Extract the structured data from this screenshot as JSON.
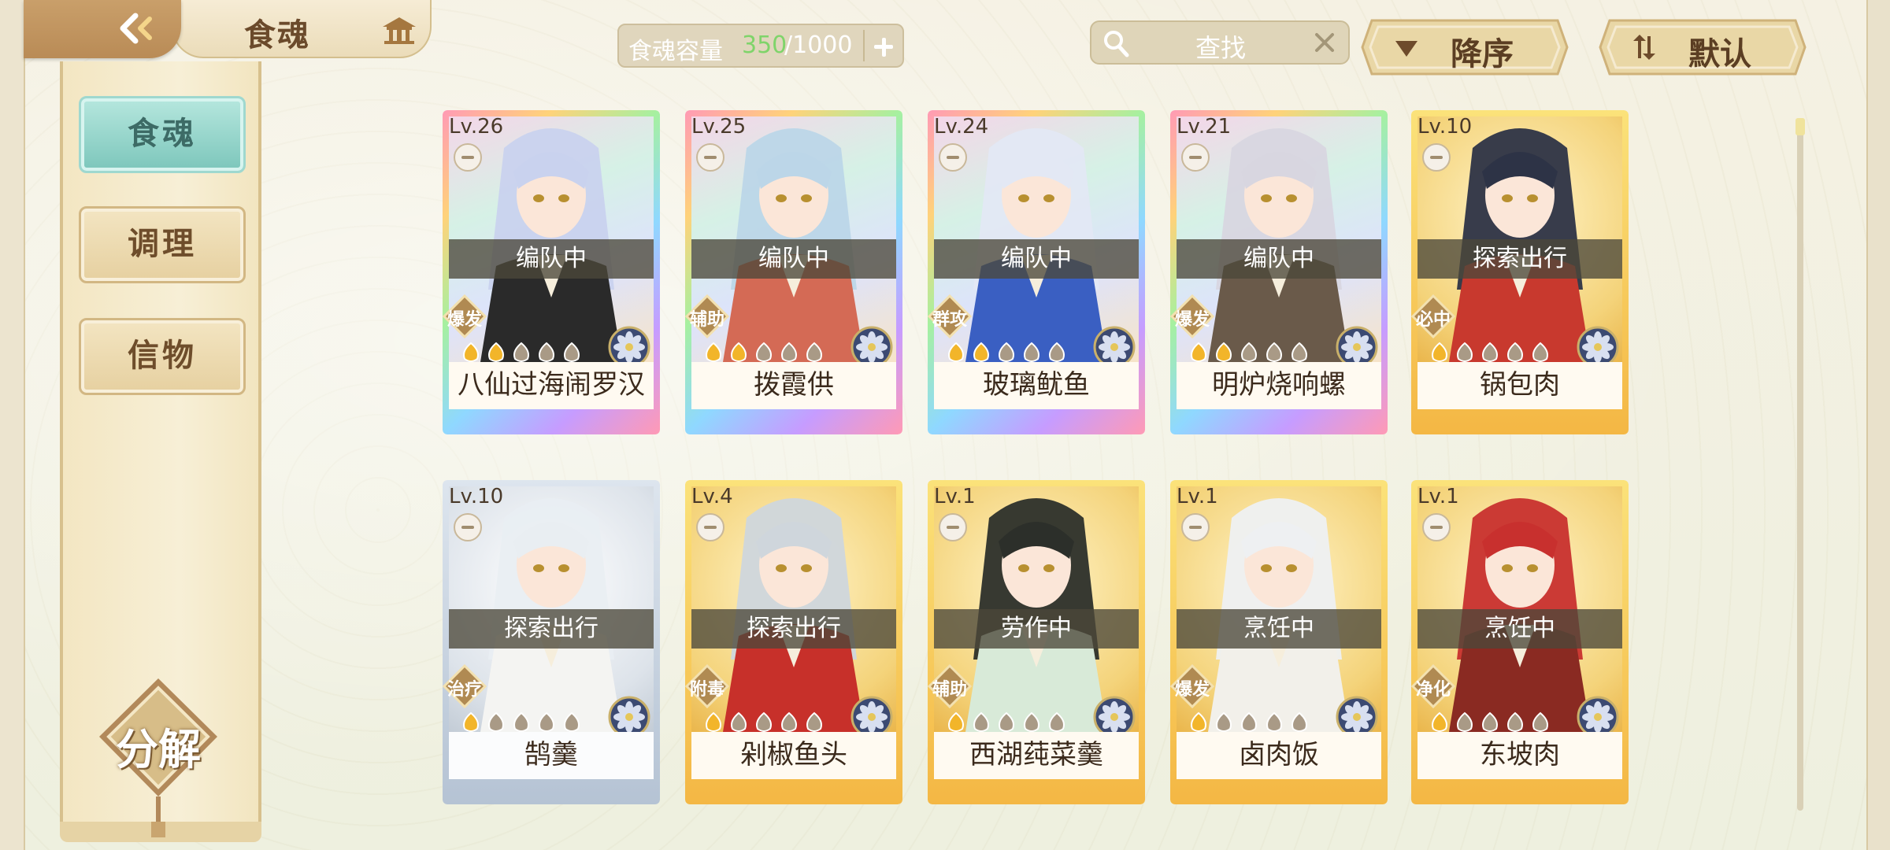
{
  "header": {
    "title": "食魂",
    "capacity_label": "食魂容量",
    "capacity_current": "350",
    "capacity_max": "/1000",
    "search_text": "查找",
    "sort_order_label": "降序",
    "sort_mode_label": "默认"
  },
  "sidebar": {
    "items": [
      {
        "label": "食魂",
        "active": true
      },
      {
        "label": "调理",
        "active": false
      },
      {
        "label": "信物",
        "active": false
      }
    ],
    "decompose_label": "分解"
  },
  "cards": [
    {
      "level": "Lv.26",
      "status": "编队中",
      "role": "爆发",
      "stars": 2,
      "name": "八仙过海闹罗汉",
      "rarity": "rainbow"
    },
    {
      "level": "Lv.25",
      "status": "编队中",
      "role": "辅助",
      "stars": 2,
      "name": "拨霞供",
      "rarity": "rainbow"
    },
    {
      "level": "Lv.24",
      "status": "编队中",
      "role": "群攻",
      "stars": 2,
      "name": "玻璃鱿鱼",
      "rarity": "rainbow"
    },
    {
      "level": "Lv.21",
      "status": "编队中",
      "role": "爆发",
      "stars": 2,
      "name": "明炉烧响螺",
      "rarity": "rainbow"
    },
    {
      "level": "Lv.10",
      "status": "探索出行",
      "role": "必中",
      "stars": 1,
      "name": "锅包肉",
      "rarity": "gold"
    },
    {
      "level": "Lv.10",
      "status": "探索出行",
      "role": "治疗",
      "stars": 1,
      "name": "鹄羹",
      "rarity": "silver"
    },
    {
      "level": "Lv.4",
      "status": "探索出行",
      "role": "附毒",
      "stars": 1,
      "name": "剁椒鱼头",
      "rarity": "gold"
    },
    {
      "level": "Lv.1",
      "status": "劳作中",
      "role": "辅助",
      "stars": 1,
      "name": "西湖莼菜羹",
      "rarity": "gold"
    },
    {
      "level": "Lv.1",
      "status": "烹饪中",
      "role": "爆发",
      "stars": 1,
      "name": "卤肉饭",
      "rarity": "gold"
    },
    {
      "level": "Lv.1",
      "status": "烹饪中",
      "role": "净化",
      "stars": 1,
      "name": "东坡肉",
      "rarity": "gold"
    }
  ],
  "icons": {
    "back": "back-arrow-icon",
    "home": "pavilion-home-icon",
    "search": "magnifier-icon",
    "clear": "close-icon",
    "sort_order": "triangle-down-icon",
    "sort_mode": "swap-icon",
    "emblem": "flower-emblem-icon",
    "star": "flame-star-icon"
  },
  "colors": {
    "capacity_current": "#7fd46a",
    "active_tab": "#7cc6bb",
    "status_overlay": "#4c483a"
  }
}
